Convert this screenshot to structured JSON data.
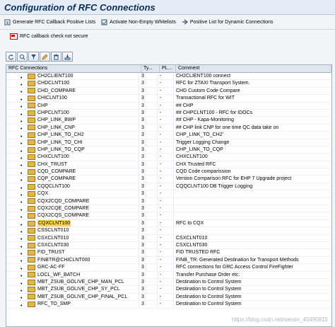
{
  "window": {
    "title": "Configuration of RFC Connections"
  },
  "toolbar": {
    "generate_label": "Generate RFC Callback Positive Lists",
    "activate_label": "Activate Non-Empty Whitelists",
    "positive_label": "Positive List for Dynamic Connections"
  },
  "status": {
    "text": "RFC callback check not secure"
  },
  "alv_icons": [
    "refresh-icon",
    "find-icon",
    "filter-icon",
    "edit-icon",
    "delete-icon",
    "export-icon"
  ],
  "table": {
    "headers": [
      "RFC Connections",
      "Ty...",
      "PL...",
      "Comment"
    ],
    "rows": [
      {
        "name": "CH2CLIENT100",
        "type": "3",
        "pl": "-",
        "comment": "CH2CLIENT100 connect",
        "selected": false
      },
      {
        "name": "CHDCLNT100",
        "type": "3",
        "pl": "-",
        "comment": "RFC for ZTAXI Transport System.",
        "selected": false
      },
      {
        "name": "CHD_COMPARE",
        "type": "3",
        "pl": "-",
        "comment": "CHD Custom Code Compare",
        "selected": false
      },
      {
        "name": "CHICLNT100",
        "type": "3",
        "pl": "-",
        "comment": "Transactional RFC for WIT",
        "selected": false
      },
      {
        "name": "CHP",
        "type": "3",
        "pl": "-",
        "comment": "## CHP",
        "selected": false
      },
      {
        "name": "CHPCLNT100",
        "type": "3",
        "pl": "-",
        "comment": "## CHPCLNT100 - RFC for IDOCs",
        "selected": false
      },
      {
        "name": "CHP_LINK_BWP",
        "type": "3",
        "pl": "-",
        "comment": "## CHP - Kapa-Monitoring",
        "selected": false
      },
      {
        "name": "CHP_LINK_CNP",
        "type": "3",
        "pl": "-",
        "comment": "## CHP link CNP for one time QC data take on",
        "selected": false
      },
      {
        "name": "CHP_LINK_TO_CH2",
        "type": "3",
        "pl": "-",
        "comment": "CHP_LINK_TO_CH2'",
        "selected": false
      },
      {
        "name": "CHP_LINK_TO_CHI",
        "type": "3",
        "pl": "-",
        "comment": "Trigger Logging Change",
        "selected": false
      },
      {
        "name": "CHP_LINK_TO_CQP",
        "type": "3",
        "pl": "-",
        "comment": "CHP_LINK_TO_CQP",
        "selected": false
      },
      {
        "name": "CHXCLNT100",
        "type": "3",
        "pl": "-",
        "comment": "CHXCLNT100",
        "selected": false
      },
      {
        "name": "CHX_TRUST",
        "type": "3",
        "pl": "-",
        "comment": "CHX Trusted RFC",
        "selected": false
      },
      {
        "name": "CQD_COMPARE",
        "type": "3",
        "pl": "-",
        "comment": "CQD Code comparission",
        "selected": false
      },
      {
        "name": "CQP_COMPARE",
        "type": "3",
        "pl": "-",
        "comment": "Version Comparison RFC for EHP 7 Upgrade project",
        "selected": false
      },
      {
        "name": "CQQCLNT100",
        "type": "3",
        "pl": "-",
        "comment": "CQQCLNT100 DB Trigger Logging",
        "selected": false
      },
      {
        "name": "CQX",
        "type": "3",
        "pl": "-",
        "comment": "",
        "selected": false
      },
      {
        "name": "CQX2CQD_COMPARE",
        "type": "3",
        "pl": "-",
        "comment": "",
        "selected": false
      },
      {
        "name": "CQX2CQE_COMPARE",
        "type": "3",
        "pl": "-",
        "comment": "",
        "selected": false
      },
      {
        "name": "CQX2CQS_COMPARE",
        "type": "3",
        "pl": "-",
        "comment": "",
        "selected": false
      },
      {
        "name": "CQXCLNT100",
        "type": "3",
        "pl": "-",
        "comment": "RFC to CQX",
        "selected": true
      },
      {
        "name": "CSSCLNT010",
        "type": "3",
        "pl": "-",
        "comment": "",
        "selected": false
      },
      {
        "name": "CSXCLNT010",
        "type": "3",
        "pl": "-",
        "comment": "CSXCLNT010",
        "selected": false
      },
      {
        "name": "CSXCLNT030",
        "type": "3",
        "pl": "-",
        "comment": "CSXCLNT030",
        "selected": false
      },
      {
        "name": "FID_TRUST",
        "type": "3",
        "pl": "-",
        "comment": "FID TRUSTED RFC",
        "selected": false
      },
      {
        "name": "FINBTR@CHICLNT000",
        "type": "3",
        "pl": "-",
        "comment": "FINB_TR: Generated Destination for Transport Methods",
        "selected": false
      },
      {
        "name": "GRC-AC-FF",
        "type": "3",
        "pl": "-",
        "comment": "RFC connections for GRC Access Control FireFighter",
        "selected": false
      },
      {
        "name": "LOCL_WF_BATCH",
        "type": "3",
        "pl": "-",
        "comment": "Transfer Purchase Order etc.",
        "selected": false
      },
      {
        "name": "MBT_ZSUB_GOLIVE_CHP_MAN_PCL",
        "type": "3",
        "pl": "-",
        "comment": "Destination to Control System",
        "selected": false
      },
      {
        "name": "MBT_ZSUB_GOLIVE_CHP_SY_PCL",
        "type": "3",
        "pl": "-",
        "comment": "Destination to Control System",
        "selected": false
      },
      {
        "name": "MBT_ZSUB_GOLIVE_CHP_FINAL_PCL",
        "type": "3",
        "pl": "-",
        "comment": "Destination to Control System",
        "selected": false
      },
      {
        "name": "RFC_TO_SMP",
        "type": "3",
        "pl": "-",
        "comment": "Destination to Control System",
        "selected": false
      }
    ]
  },
  "watermark": "https://blog.csdn.net/weixin_45490815"
}
